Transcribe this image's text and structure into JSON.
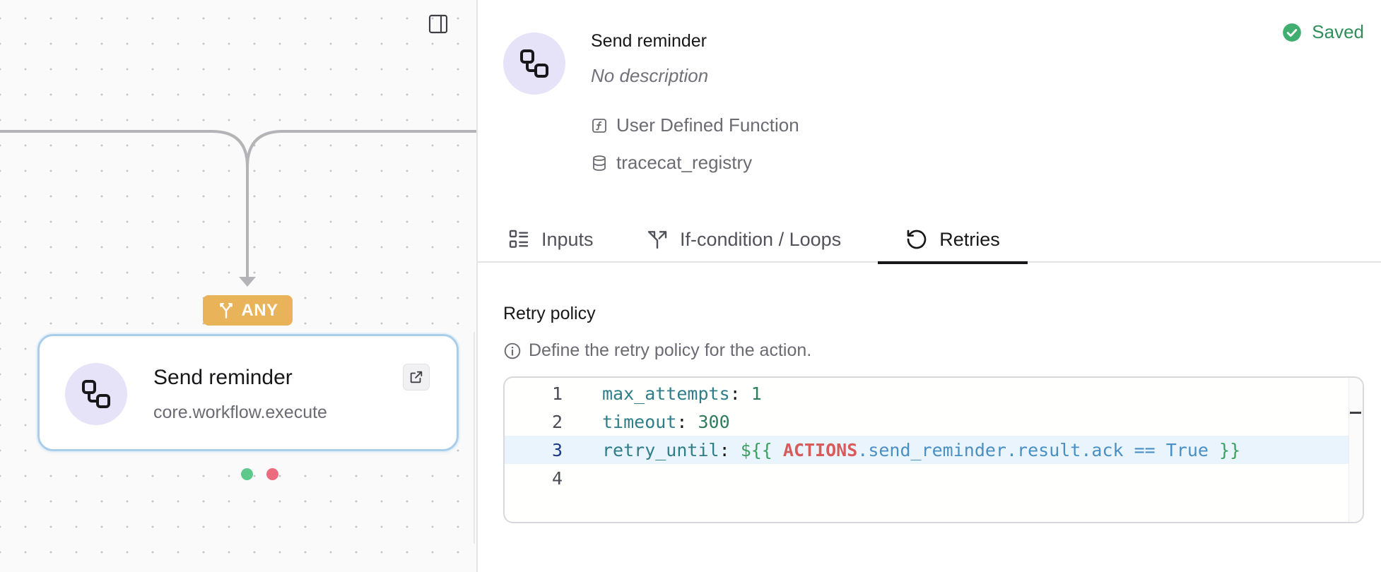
{
  "canvas": {
    "join_label": "ANY",
    "node": {
      "title": "Send reminder",
      "subtitle": "core.workflow.execute"
    },
    "icons": {
      "panel_toggle": "panel-right-icon",
      "join": "merge-icon",
      "node": "workflow-icon",
      "open": "external-link-icon"
    },
    "colors": {
      "join_badge": "#e9b35a",
      "node_border": "#a9cdea",
      "success_handle": "#5fc98b",
      "error_handle": "#ec6b7d"
    }
  },
  "panel": {
    "action_title": "Send reminder",
    "description": "No description",
    "type": "User Defined Function",
    "registry": "tracecat_registry",
    "status": "Saved",
    "status_color": "#2f8f5b",
    "tabs": [
      {
        "label": "Inputs",
        "icon": "list-icon"
      },
      {
        "label": "If-condition / Loops",
        "icon": "split-icon"
      },
      {
        "label": "Retries",
        "icon": "rotate-ccw-icon",
        "active": true
      }
    ],
    "retry": {
      "title": "Retry policy",
      "hint": "Define the retry policy for the action.",
      "lines": [
        {
          "n": "1",
          "key": "max_attempts",
          "value": "1"
        },
        {
          "n": "2",
          "key": "timeout",
          "value": "300"
        },
        {
          "n": "3",
          "key": "retry_until",
          "open": "${{",
          "actions": "ACTIONS",
          "expr": ".send_reminder.result.ack == True",
          "close": "}}"
        },
        {
          "n": "4"
        }
      ]
    }
  }
}
